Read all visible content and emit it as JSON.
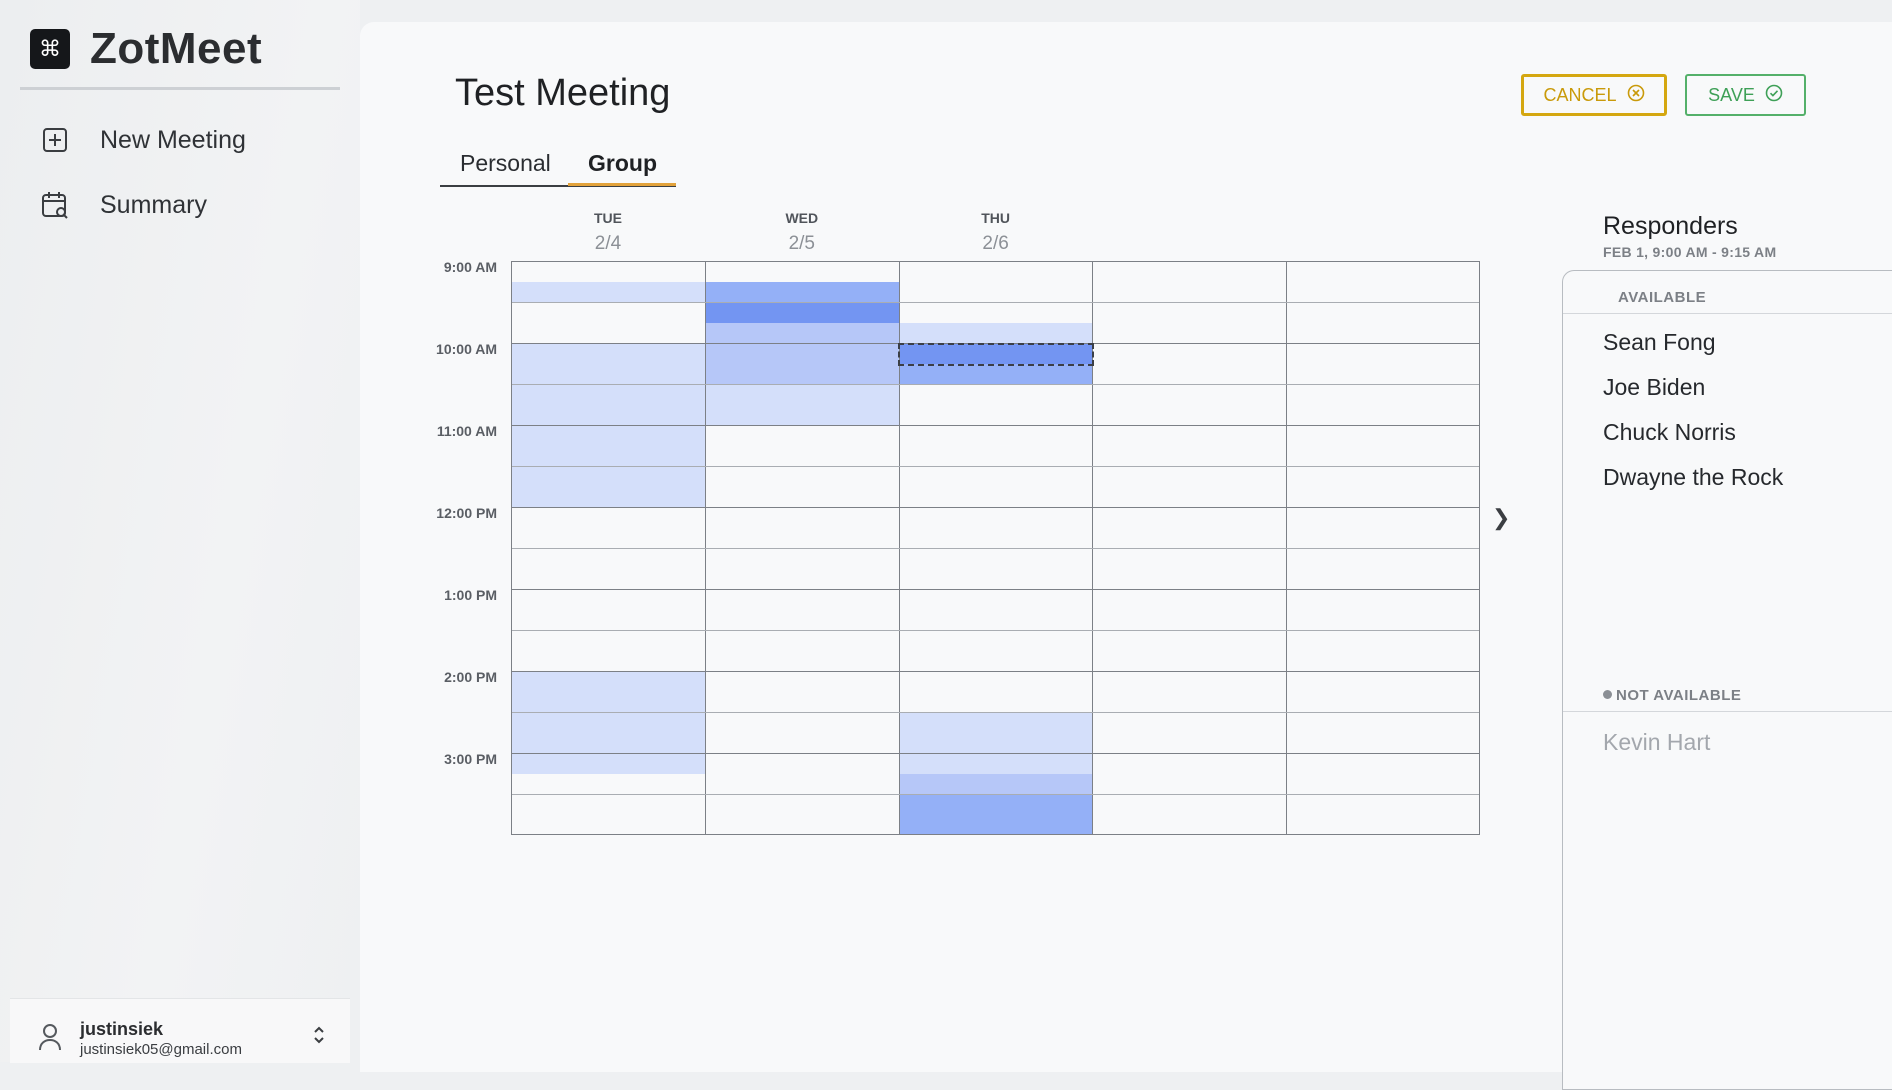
{
  "app": {
    "name": "ZotMeet",
    "logo_glyph": "⌘"
  },
  "sidebar": {
    "items": [
      {
        "label": "New Meeting",
        "icon": "plus-square-icon"
      },
      {
        "label": "Summary",
        "icon": "calendar-search-icon"
      }
    ]
  },
  "user": {
    "username": "justinsiek",
    "email": "justinsiek05@gmail.com"
  },
  "meeting": {
    "title": "Test Meeting"
  },
  "actions": {
    "cancel_label": "CANCEL",
    "save_label": "SAVE",
    "cancel_color": "#c99a0a",
    "save_color": "#3ea057"
  },
  "tabs": {
    "personal": "Personal",
    "group": "Group",
    "active": "group",
    "active_underline_color": "#e2a23b"
  },
  "schedule": {
    "days": [
      {
        "dow": "TUE",
        "date": "2/4"
      },
      {
        "dow": "WED",
        "date": "2/5"
      },
      {
        "dow": "THU",
        "date": "2/6"
      },
      {
        "dow": "",
        "date": ""
      },
      {
        "dow": "",
        "date": ""
      }
    ],
    "time_labels": [
      "9:00 AM",
      "10:00 AM",
      "11:00 AM",
      "12:00 PM",
      "1:00 PM",
      "2:00 PM",
      "3:00 PM"
    ],
    "slots_per_day": 28,
    "selected": {
      "day": 2,
      "slot": 4
    },
    "availability_colors": [
      "#d4dffa",
      "#b6c7f8",
      "#94b0f7",
      "#7395f2",
      "#5a83f0"
    ],
    "availability": [
      [
        0,
        1,
        0,
        0,
        1,
        1,
        1,
        1,
        1,
        1,
        1,
        1,
        0,
        0,
        0,
        0,
        0,
        0,
        0,
        0,
        1,
        1,
        1,
        1,
        1,
        0,
        0,
        0
      ],
      [
        0,
        3,
        4,
        2,
        2,
        2,
        1,
        1,
        0,
        0,
        0,
        0,
        0,
        0,
        0,
        0,
        0,
        0,
        0,
        0,
        0,
        0,
        0,
        0,
        0,
        0,
        0,
        0
      ],
      [
        0,
        0,
        0,
        1,
        4,
        3,
        0,
        0,
        0,
        0,
        0,
        0,
        0,
        0,
        0,
        0,
        0,
        0,
        0,
        0,
        0,
        0,
        1,
        1,
        1,
        2,
        3,
        3
      ],
      [
        0,
        0,
        0,
        0,
        0,
        0,
        0,
        0,
        0,
        0,
        0,
        0,
        0,
        0,
        0,
        0,
        0,
        0,
        0,
        0,
        0,
        0,
        0,
        0,
        0,
        0,
        0,
        0
      ],
      [
        0,
        0,
        0,
        0,
        0,
        0,
        0,
        0,
        0,
        0,
        0,
        0,
        0,
        0,
        0,
        0,
        0,
        0,
        0,
        0,
        0,
        0,
        0,
        0,
        0,
        0,
        0,
        0
      ]
    ]
  },
  "responders": {
    "title": "Responders",
    "subtitle": "FEB 1, 9:00 AM - 9:15 AM",
    "available_label": "AVAILABLE",
    "available": [
      "Sean Fong",
      "Joe Biden",
      "Chuck Norris",
      "Dwayne the Rock"
    ],
    "not_available_label": "NOT AVAILABLE",
    "not_available": [
      "Kevin Hart"
    ]
  }
}
